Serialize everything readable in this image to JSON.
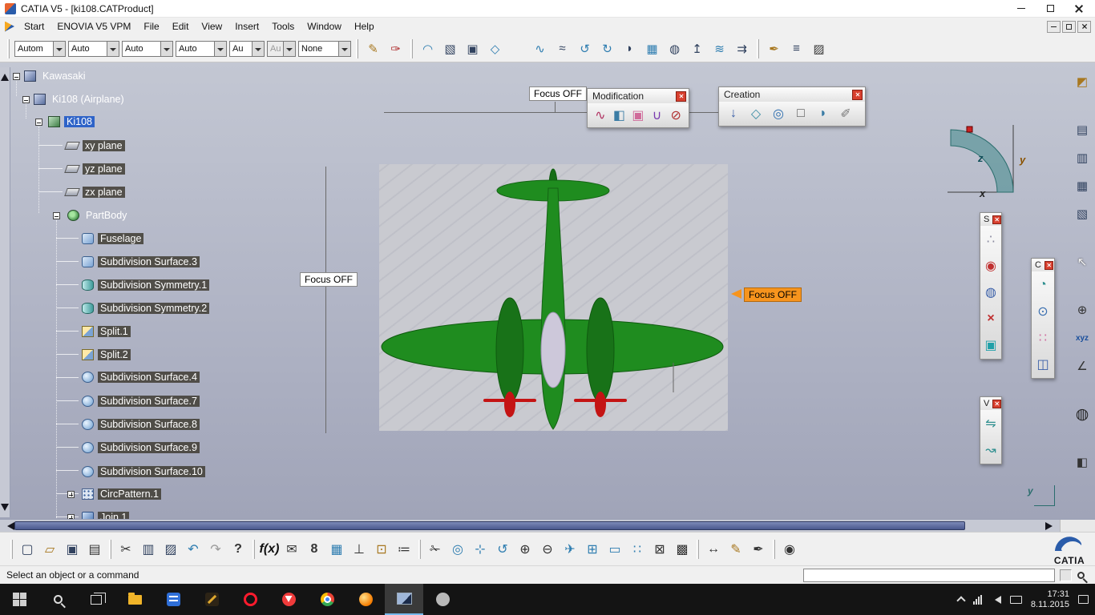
{
  "window": {
    "title": "CATIA V5 - [ki108.CATProduct]"
  },
  "menubar": {
    "items": [
      "Start",
      "ENOVIA V5 VPM",
      "File",
      "Edit",
      "View",
      "Insert",
      "Tools",
      "Window",
      "Help"
    ]
  },
  "combos": [
    {
      "value": "Autom"
    },
    {
      "value": "Auto"
    },
    {
      "value": "Auto"
    },
    {
      "value": "Auto"
    },
    {
      "value": "Au"
    },
    {
      "value": "Au"
    },
    {
      "value": "None"
    }
  ],
  "top_icons": [
    {
      "name": "sketch",
      "glyph": "✎"
    },
    {
      "name": "brush",
      "glyph": "✑"
    },
    {
      "name": "arc",
      "glyph": "◠"
    },
    {
      "name": "shaded-box",
      "glyph": "▧"
    },
    {
      "name": "instance",
      "glyph": "▣"
    },
    {
      "name": "plane-symbol",
      "glyph": "◇"
    },
    {
      "name": "swap-arrows",
      "glyph": "⇄"
    },
    {
      "name": "curve",
      "glyph": "∿"
    },
    {
      "name": "spline",
      "glyph": "≈"
    },
    {
      "name": "rotate-left",
      "glyph": "↺"
    },
    {
      "name": "rotate-right",
      "glyph": "↻"
    },
    {
      "name": "fillet",
      "glyph": "◗"
    },
    {
      "name": "grid",
      "glyph": "▦"
    },
    {
      "name": "sphere",
      "glyph": "◍"
    },
    {
      "name": "extrude",
      "glyph": "↥"
    },
    {
      "name": "wave",
      "glyph": "≋"
    },
    {
      "name": "project",
      "glyph": "⇉"
    },
    {
      "name": "pen",
      "glyph": "✒"
    },
    {
      "name": "layers",
      "glyph": "≡"
    },
    {
      "name": "hatch",
      "glyph": "▨"
    }
  ],
  "tree": {
    "items": [
      {
        "label": "Kawasaki"
      },
      {
        "label": "Ki108 (Airplane)"
      },
      {
        "label": "Ki108"
      },
      {
        "label": "xy plane"
      },
      {
        "label": "yz plane"
      },
      {
        "label": "zx plane"
      },
      {
        "label": "PartBody"
      },
      {
        "label": "Fuselage"
      },
      {
        "label": "Subdivision Surface.3"
      },
      {
        "label": "Subdivision Symmetry.1"
      },
      {
        "label": "Subdivision Symmetry.2"
      },
      {
        "label": "Split.1"
      },
      {
        "label": "Split.2"
      },
      {
        "label": "Subdivision Surface.4"
      },
      {
        "label": "Subdivision Surface.7"
      },
      {
        "label": "Subdivision Surface.8"
      },
      {
        "label": "Subdivision Surface.9"
      },
      {
        "label": "Subdivision Surface.10"
      },
      {
        "label": "CircPattern.1"
      },
      {
        "label": "Join.1"
      }
    ]
  },
  "focus_labels": {
    "top": "Focus OFF",
    "left": "Focus OFF",
    "right": "Focus OFF"
  },
  "palettes": {
    "modification": {
      "title": "Modification",
      "icons": [
        {
          "name": "edit-spline",
          "glyph": "∿"
        },
        {
          "name": "modify-surface",
          "glyph": "◧"
        },
        {
          "name": "face-box",
          "glyph": "▣"
        },
        {
          "name": "attract",
          "glyph": "∪"
        },
        {
          "name": "erase",
          "glyph": "⊘"
        }
      ]
    },
    "creation": {
      "title": "Creation",
      "icons": [
        {
          "name": "point",
          "glyph": "↓"
        },
        {
          "name": "plane",
          "glyph": "◇"
        },
        {
          "name": "cylinder",
          "glyph": "◎"
        },
        {
          "name": "rectangle",
          "glyph": "□"
        },
        {
          "name": "half-disc",
          "glyph": "◗"
        },
        {
          "name": "cutter",
          "glyph": "✐"
        }
      ]
    },
    "s": {
      "title": "S",
      "icons": [
        {
          "name": "molecule",
          "glyph": "∴"
        },
        {
          "name": "red-sphere",
          "glyph": "◉"
        },
        {
          "name": "wire-sphere",
          "glyph": "◍"
        },
        {
          "name": "delete",
          "glyph": "×"
        },
        {
          "name": "cyan-box",
          "glyph": "▣"
        }
      ]
    },
    "c": {
      "title": "C",
      "icons": [
        {
          "name": "surface-patch",
          "glyph": "◔"
        },
        {
          "name": "revolve",
          "glyph": "⊙"
        },
        {
          "name": "point-grid",
          "glyph": "∷"
        },
        {
          "name": "wire-cube",
          "glyph": "◫"
        }
      ]
    },
    "v": {
      "title": "V",
      "icons": [
        {
          "name": "flip-view",
          "glyph": "⇋"
        },
        {
          "name": "sweep-view",
          "glyph": "↝"
        }
      ]
    }
  },
  "compass": {
    "x": "x",
    "y": "y",
    "z": "z"
  },
  "viewport_axis": {
    "label": "y"
  },
  "right_dock_icons": [
    {
      "name": "paint",
      "glyph": "◩"
    },
    {
      "name": "layer-list-1",
      "glyph": "▤"
    },
    {
      "name": "layer-list-2",
      "glyph": "▥"
    },
    {
      "name": "layer-list-3",
      "glyph": "▦"
    },
    {
      "name": "layer-list-4",
      "glyph": "▧"
    },
    {
      "name": "select-cursor",
      "glyph": "↖"
    },
    {
      "name": "zoom-area",
      "glyph": "⊕"
    },
    {
      "name": "xyz",
      "glyph": "xyz"
    },
    {
      "name": "axis-target",
      "glyph": "∠"
    },
    {
      "name": "orbit-globe",
      "glyph": "◍"
    },
    {
      "name": "shade-mode",
      "glyph": "◧"
    }
  ],
  "bottom_icons": [
    {
      "name": "new-document",
      "glyph": "▢"
    },
    {
      "name": "open-folder",
      "glyph": "▱"
    },
    {
      "name": "save",
      "glyph": "▣"
    },
    {
      "name": "print",
      "glyph": "▤"
    },
    {
      "name": "cut",
      "glyph": "✂"
    },
    {
      "name": "copy",
      "glyph": "▥"
    },
    {
      "name": "paste",
      "glyph": "▨"
    },
    {
      "name": "undo",
      "glyph": "↶"
    },
    {
      "name": "redo",
      "glyph": "↷"
    },
    {
      "name": "whats-this",
      "glyph": "?"
    },
    {
      "name": "formula",
      "glyph": "f(x)"
    },
    {
      "name": "comment",
      "glyph": "✉"
    },
    {
      "name": "knowledge",
      "glyph": "8"
    },
    {
      "name": "design-table",
      "glyph": "▦"
    },
    {
      "name": "axis-system",
      "glyph": "⊥"
    },
    {
      "name": "catalog",
      "glyph": "⊡"
    },
    {
      "name": "rules",
      "glyph": "≔"
    },
    {
      "name": "trim",
      "glyph": "✁"
    },
    {
      "name": "center-view",
      "glyph": "◎"
    },
    {
      "name": "pan",
      "glyph": "⊹"
    },
    {
      "name": "rotate-view",
      "glyph": "↺"
    },
    {
      "name": "zoom-in",
      "glyph": "⊕"
    },
    {
      "name": "zoom-out",
      "glyph": "⊖"
    },
    {
      "name": "normal-view",
      "glyph": "✈"
    },
    {
      "name": "multi-view",
      "glyph": "⊞"
    },
    {
      "name": "quick-view",
      "glyph": "▭"
    },
    {
      "name": "render-style",
      "glyph": "∷"
    },
    {
      "name": "hide-show",
      "glyph": "⊠"
    },
    {
      "name": "swap-space",
      "glyph": "▩"
    },
    {
      "name": "measure",
      "glyph": "↔"
    },
    {
      "name": "annotate",
      "glyph": "✎"
    },
    {
      "name": "ink",
      "glyph": "✒"
    },
    {
      "name": "capture",
      "glyph": "◉"
    }
  ],
  "statusbar": {
    "message": "Select an object or a command"
  },
  "logo": {
    "text": "CATIA"
  },
  "taskbar": {
    "time": "17:31",
    "date": "8.11.2015"
  }
}
